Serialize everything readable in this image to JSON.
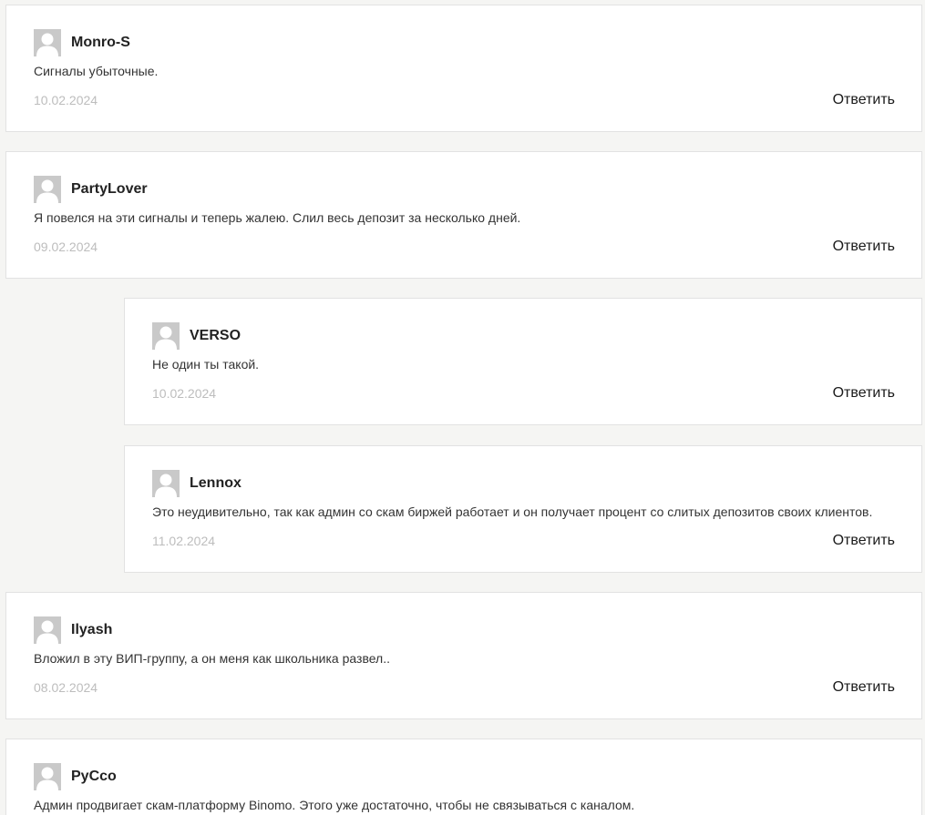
{
  "comments": [
    {
      "author": "Monro-S",
      "text": "Сигналы убыточные.",
      "date": "10.02.2024",
      "reply_label": "Ответить"
    },
    {
      "author": "PartyLover",
      "text": "Я повелся на эти сигналы и теперь жалею. Слил весь депозит за несколько дней.",
      "date": "09.02.2024",
      "reply_label": "Ответить"
    },
    {
      "author": "VERSO",
      "text": "Не один ты такой.",
      "date": "10.02.2024",
      "reply_label": "Ответить"
    },
    {
      "author": "Lennox",
      "text": "Это неудивительно, так как админ со скам биржей работает и он получает процент со слитых депозитов своих клиентов.",
      "date": "11.02.2024",
      "reply_label": "Ответить"
    },
    {
      "author": "Ilyash",
      "text": "Вложил в эту ВИП-группу, а он меня как школьника развел..",
      "date": "08.02.2024",
      "reply_label": "Ответить"
    },
    {
      "author": "PyCco",
      "text": "Админ продвигает скам-платформу Binomo. Этого уже достаточно, чтобы не связываться с каналом.",
      "date": "",
      "reply_label": ""
    }
  ]
}
